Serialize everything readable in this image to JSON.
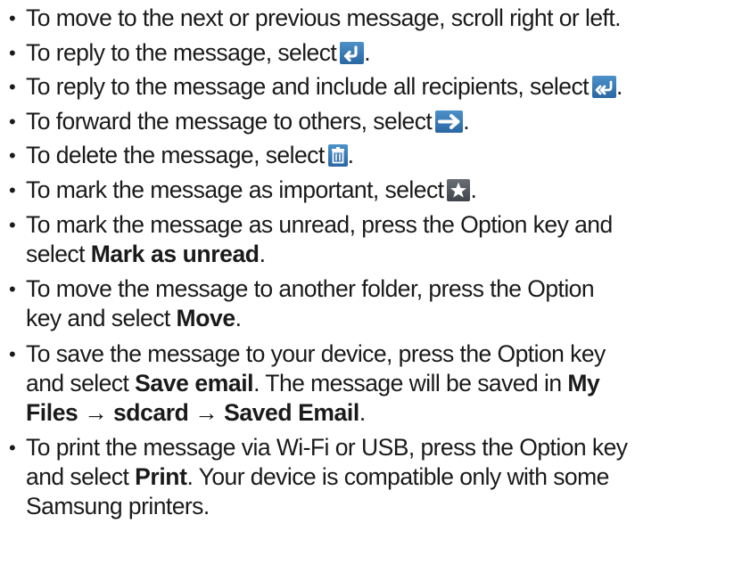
{
  "items": [
    {
      "text": "To move to the next or previous message, scroll right or left."
    },
    {
      "pre": "To reply to the message, select",
      "post": ".",
      "icon": "reply-icon"
    },
    {
      "pre": "To reply to the message and include all recipients, select",
      "post": ".",
      "icon": "reply-all-icon"
    },
    {
      "pre": "To forward the message to others, select",
      "post": ".",
      "icon": "forward-icon"
    },
    {
      "pre": "To delete the message, select",
      "post": ".",
      "icon": "delete-icon"
    },
    {
      "pre": "To mark the message as important, select",
      "post": ".",
      "icon": "star-icon"
    },
    {
      "line1": "To mark the message as unread, press the Option key and",
      "pre2": "select ",
      "bold": "Mark as unread",
      "post": "."
    },
    {
      "line1": "To move the message to another folder, press the Option",
      "pre2": "key and select ",
      "bold": "Move",
      "post": "."
    },
    {
      "line1": "To save the message to your device, press the Option key",
      "pre2": "and select ",
      "bold1": "Save email",
      "mid": ". The message will be saved in ",
      "bold2": "My",
      "bold3": "Files",
      "arrow1": " → ",
      "bold4": "sdcard",
      "arrow2": " → ",
      "bold5": "Saved Email",
      "post": "."
    },
    {
      "line1": "To print the message via Wi-Fi or USB, press the Option key",
      "pre2": "and select ",
      "bold": "Print",
      "mid": ". Your device is compatible only with some",
      "line3": "Samsung printers."
    }
  ],
  "bullet_char": "•",
  "colors": {
    "icon_blue": "#3a7bbf",
    "icon_dark": "#4d5258",
    "text": "#1a1a1a"
  }
}
